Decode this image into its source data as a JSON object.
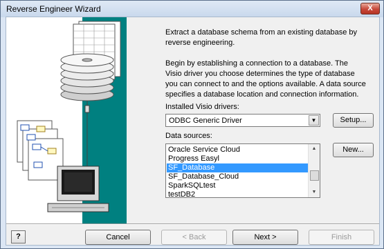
{
  "window": {
    "title": "Reverse Engineer Wizard",
    "close_label": "X"
  },
  "intro": {
    "paragraph1": "Extract a database schema from an existing database by reverse engineering.",
    "paragraph2": "Begin by establishing a connection to a database.  The Visio driver you choose determines the type of database you can connect to and the options available.  A data source specifies a database location and connection information."
  },
  "drivers": {
    "label": "Installed Visio drivers:",
    "selected": "ODBC Generic Driver",
    "setup_label": "Setup..."
  },
  "sources": {
    "label": "Data sources:",
    "new_label": "New...",
    "items": [
      "Oracle Service Cloud",
      "Progress Easyl",
      "SF_Database",
      "SF_Database_Cloud",
      "SparkSQLtest",
      "testDB2"
    ],
    "selected_index": 2
  },
  "footer": {
    "help_label": "?",
    "cancel_label": "Cancel",
    "back_label": "< Back",
    "next_label": "Next >",
    "finish_label": "Finish"
  }
}
